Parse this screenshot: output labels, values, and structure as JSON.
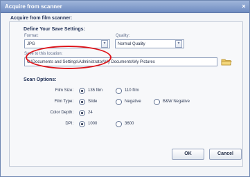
{
  "window": {
    "title": "Acquire from scanner",
    "close_glyph": "×"
  },
  "section_title": "Acquire from film scanner:",
  "save_settings": {
    "heading": "Define Your Save Settings:",
    "format": {
      "label": "Format:",
      "value": "JPG"
    },
    "quality": {
      "label": "Quality:",
      "value": "Normal Quality"
    },
    "location": {
      "label": "Save to this location:",
      "value": "C:\\Documents and Settings\\Administrator\\My Documents\\My Pictures"
    }
  },
  "scan_options": {
    "heading": "Scan Options:",
    "film_size": {
      "label": "Film Size:",
      "options": [
        "135 film",
        "110 film"
      ],
      "selected": 0
    },
    "film_type": {
      "label": "Film Type:",
      "options": [
        "Slide",
        "Negative",
        "B&W Negative"
      ],
      "selected": 0
    },
    "color_depth": {
      "label": "Color Depth:",
      "options": [
        "24"
      ],
      "selected": 0
    },
    "dpi": {
      "label": "DPI:",
      "options": [
        "1000",
        "3600"
      ],
      "selected": 0
    }
  },
  "buttons": {
    "ok": "OK",
    "cancel": "Cancel"
  },
  "icons": {
    "dropdown": "chevron-down-icon",
    "folder": "folder-icon",
    "close": "close-icon"
  },
  "colors": {
    "highlight": "#e0161b",
    "titlebar": "#7d97c8"
  }
}
